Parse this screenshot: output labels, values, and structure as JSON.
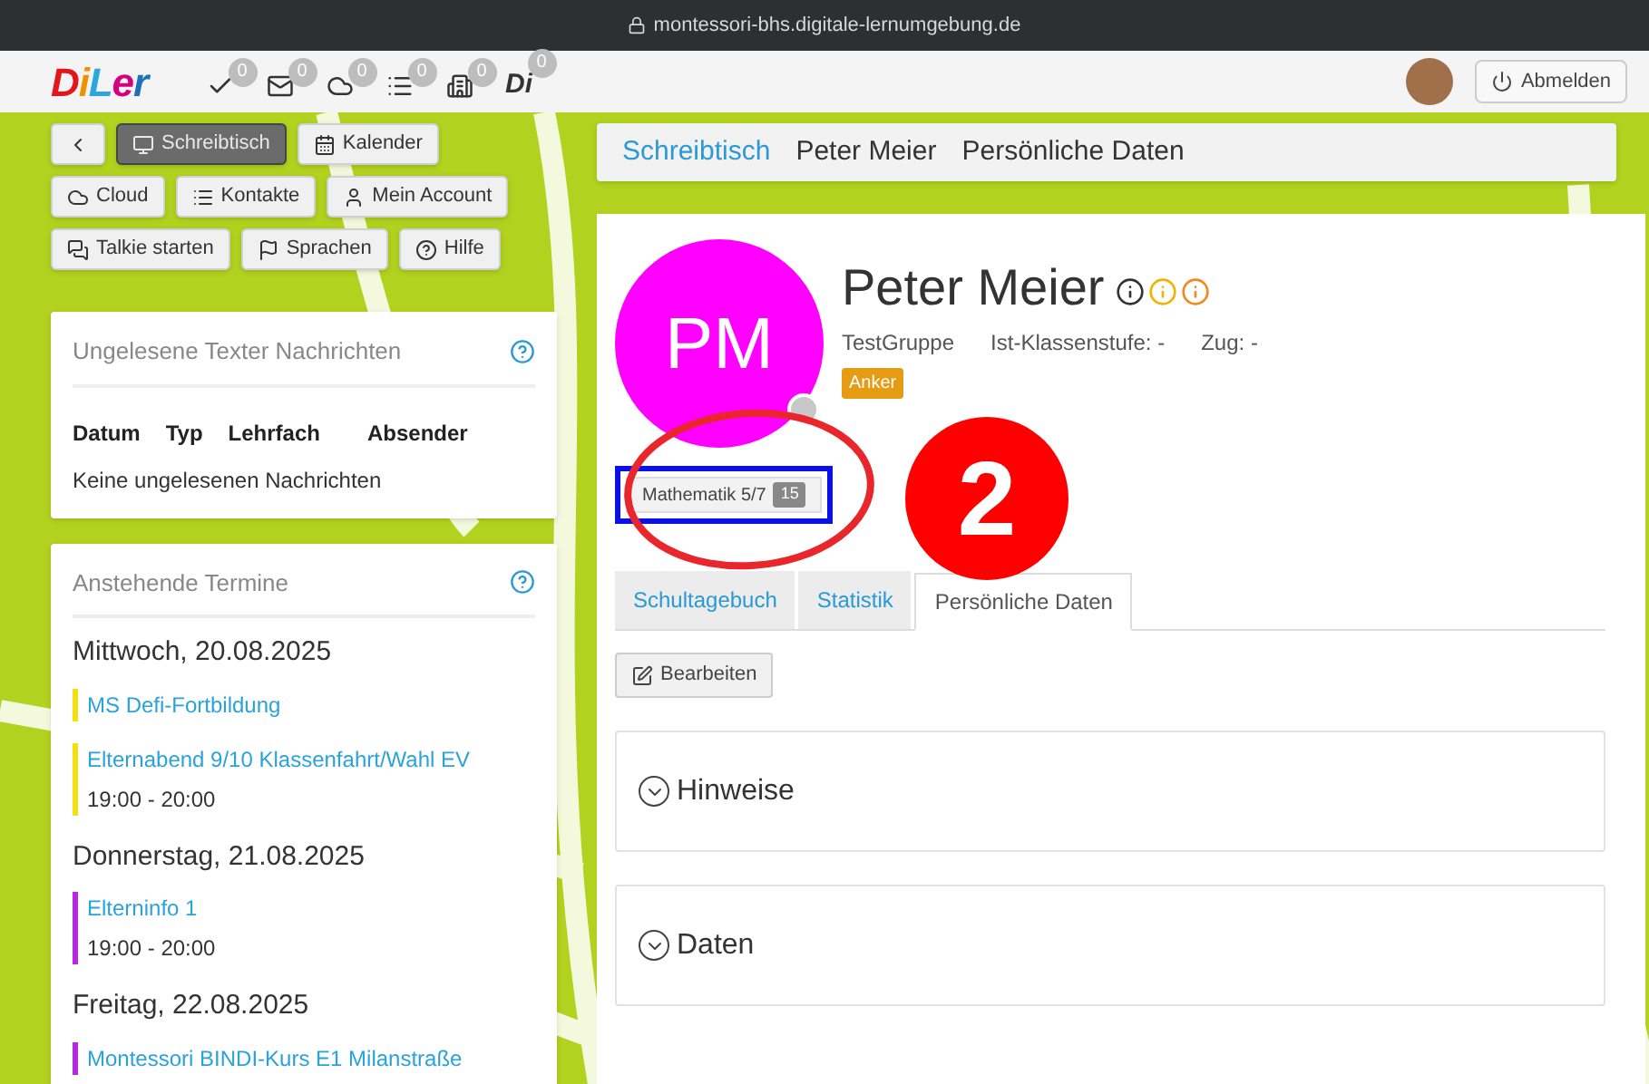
{
  "browser": {
    "url": "montessori-bhs.digitale-lernumgebung.de"
  },
  "header": {
    "logo": "DiLer",
    "icons": [
      {
        "kind": "check",
        "badge": "0"
      },
      {
        "kind": "mail",
        "badge": "0"
      },
      {
        "kind": "cloud",
        "badge": "0"
      },
      {
        "kind": "list",
        "badge": "0"
      },
      {
        "kind": "building",
        "badge": "0"
      },
      {
        "kind": "text",
        "label": "Di",
        "badge": "0"
      }
    ],
    "logout": "Abmelden"
  },
  "nav_buttons": [
    {
      "kind": "back",
      "selected": false
    },
    {
      "kind": "desk",
      "label": "Schreibtisch",
      "selected": true
    },
    {
      "kind": "calendar",
      "label": "Kalender",
      "selected": false
    },
    {
      "kind": "cloud",
      "label": "Cloud",
      "selected": false
    },
    {
      "kind": "list",
      "label": "Kontakte",
      "selected": false
    },
    {
      "kind": "user",
      "label": "Mein Account",
      "selected": false
    },
    {
      "kind": "chat",
      "label": "Talkie starten",
      "selected": false
    },
    {
      "kind": "flag",
      "label": "Sprachen",
      "selected": false
    },
    {
      "kind": "help",
      "label": "Hilfe",
      "selected": false
    }
  ],
  "messages_card": {
    "title": "Ungelesene Texter Nachrichten",
    "columns": [
      "Datum",
      "Typ",
      "Lehrfach",
      "Absender"
    ],
    "empty": "Keine ungelesenen Nachrichten"
  },
  "events_card": {
    "title": "Anstehende Termine",
    "days": [
      {
        "date": "Mittwoch, 20.08.2025",
        "events": [
          {
            "title": "MS Defi-Fortbildung",
            "color": "#f2e012"
          },
          {
            "title": "Elternabend 9/10 Klassenfahrt/Wahl EV",
            "time": "19:00 - 20:00",
            "color": "#f2e012"
          }
        ]
      },
      {
        "date": "Donnerstag, 21.08.2025",
        "events": [
          {
            "title": "Elterninfo 1",
            "time": "19:00 - 20:00",
            "color": "#b629e0"
          }
        ]
      },
      {
        "date": "Freitag, 22.08.2025",
        "events": [
          {
            "title": "Montessori BINDI-Kurs E1 Milanstraße",
            "color": "#b629e0"
          }
        ]
      }
    ]
  },
  "breadcrumb": [
    {
      "label": "Schreibtisch",
      "link": true
    },
    {
      "label": "Peter Meier",
      "link": false
    },
    {
      "label": "Persönliche Daten",
      "link": false
    }
  ],
  "profile": {
    "initials": "PM",
    "name": "Peter Meier",
    "info_icons": [
      {
        "color": "#333333"
      },
      {
        "color": "#f0b400"
      },
      {
        "color": "#f08a1c"
      }
    ],
    "meta": [
      "TestGruppe",
      "Ist-Klassenstufe: -",
      "Zug: -"
    ],
    "tag": "Anker",
    "course": {
      "label": "Mathematik 5/7",
      "count": "15"
    }
  },
  "tabs": [
    {
      "label": "Schultagebuch",
      "selected": false
    },
    {
      "label": "Statistik",
      "selected": false
    },
    {
      "label": "Persönliche Daten",
      "selected": true
    }
  ],
  "edit_button": "Bearbeiten",
  "sections": [
    {
      "title": "Hinweise",
      "expanded": false
    },
    {
      "title": "Daten",
      "expanded": false
    }
  ],
  "annotation": {
    "number": "2"
  }
}
